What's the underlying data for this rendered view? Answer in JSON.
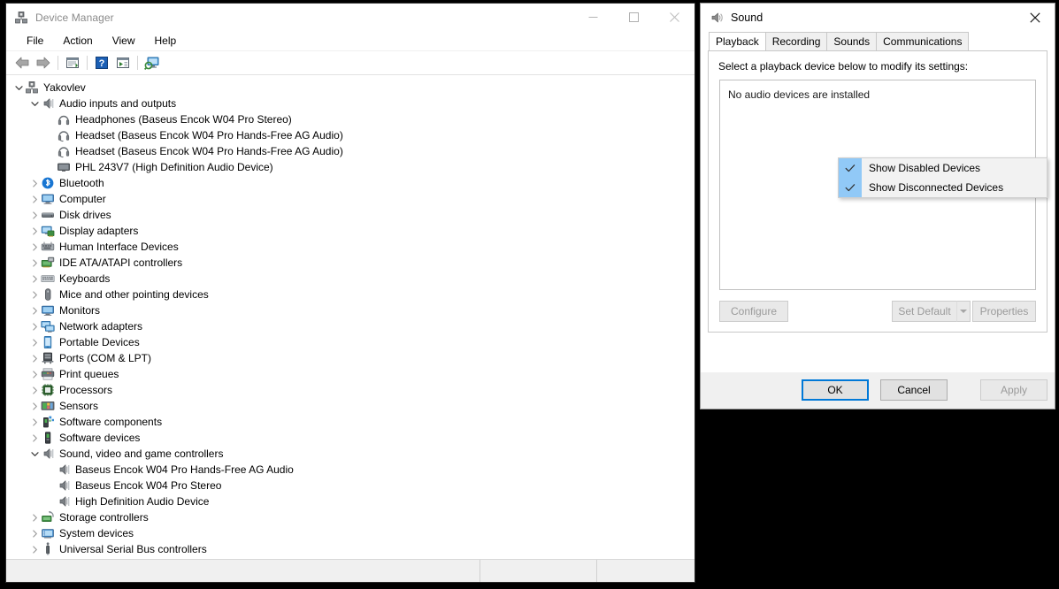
{
  "device_manager": {
    "title": "Device Manager",
    "title_icon": "device-manager-icon",
    "window_buttons": [
      {
        "name": "minimize",
        "glyph": "minimize-icon"
      },
      {
        "name": "maximize",
        "glyph": "maximize-icon"
      },
      {
        "name": "close",
        "glyph": "close-icon"
      }
    ],
    "menu": [
      "File",
      "Action",
      "View",
      "Help"
    ],
    "toolbar": [
      {
        "name": "back-icon"
      },
      {
        "name": "forward-icon"
      },
      {
        "sep": true
      },
      {
        "name": "properties-icon"
      },
      {
        "sep": true
      },
      {
        "name": "help-icon"
      },
      {
        "name": "update-driver-icon"
      },
      {
        "sep": true
      },
      {
        "name": "scan-hardware-icon"
      }
    ],
    "tree": [
      {
        "label": "Yakovlev",
        "indent": 0,
        "twisty": "down",
        "icon": "computer-tree-icon"
      },
      {
        "label": "Audio inputs and outputs",
        "indent": 1,
        "twisty": "down",
        "icon": "speaker-icon"
      },
      {
        "label": "Headphones (Baseus Encok W04 Pro Stereo)",
        "indent": 2,
        "twisty": "none",
        "icon": "headphones-icon"
      },
      {
        "label": "Headset (Baseus Encok W04 Pro Hands-Free AG Audio)",
        "indent": 2,
        "twisty": "none",
        "icon": "headset-icon"
      },
      {
        "label": "Headset (Baseus Encok W04 Pro Hands-Free AG Audio)",
        "indent": 2,
        "twisty": "none",
        "icon": "headset-icon"
      },
      {
        "label": "PHL 243V7 (High Definition Audio Device)",
        "indent": 2,
        "twisty": "none",
        "icon": "monitor-icon"
      },
      {
        "label": "Bluetooth",
        "indent": 1,
        "twisty": "right",
        "icon": "bluetooth-icon"
      },
      {
        "label": "Computer",
        "indent": 1,
        "twisty": "right",
        "icon": "computer-icon"
      },
      {
        "label": "Disk drives",
        "indent": 1,
        "twisty": "right",
        "icon": "disk-icon"
      },
      {
        "label": "Display adapters",
        "indent": 1,
        "twisty": "right",
        "icon": "display-adapter-icon"
      },
      {
        "label": "Human Interface Devices",
        "indent": 1,
        "twisty": "right",
        "icon": "hid-icon"
      },
      {
        "label": "IDE ATA/ATAPI controllers",
        "indent": 1,
        "twisty": "right",
        "icon": "ide-icon"
      },
      {
        "label": "Keyboards",
        "indent": 1,
        "twisty": "right",
        "icon": "keyboard-icon"
      },
      {
        "label": "Mice and other pointing devices",
        "indent": 1,
        "twisty": "right",
        "icon": "mouse-icon"
      },
      {
        "label": "Monitors",
        "indent": 1,
        "twisty": "right",
        "icon": "monitor2-icon"
      },
      {
        "label": "Network adapters",
        "indent": 1,
        "twisty": "right",
        "icon": "network-icon"
      },
      {
        "label": "Portable Devices",
        "indent": 1,
        "twisty": "right",
        "icon": "portable-icon"
      },
      {
        "label": "Ports (COM & LPT)",
        "indent": 1,
        "twisty": "right",
        "icon": "port-icon"
      },
      {
        "label": "Print queues",
        "indent": 1,
        "twisty": "right",
        "icon": "printer-icon"
      },
      {
        "label": "Processors",
        "indent": 1,
        "twisty": "right",
        "icon": "processor-icon"
      },
      {
        "label": "Sensors",
        "indent": 1,
        "twisty": "right",
        "icon": "sensor-icon"
      },
      {
        "label": "Software components",
        "indent": 1,
        "twisty": "right",
        "icon": "software-component-icon"
      },
      {
        "label": "Software devices",
        "indent": 1,
        "twisty": "right",
        "icon": "software-device-icon"
      },
      {
        "label": "Sound, video and game controllers",
        "indent": 1,
        "twisty": "down",
        "icon": "speaker-icon"
      },
      {
        "label": "Baseus Encok W04 Pro Hands-Free AG Audio",
        "indent": 2,
        "twisty": "none",
        "icon": "speaker-small-icon"
      },
      {
        "label": "Baseus Encok W04 Pro Stereo",
        "indent": 2,
        "twisty": "none",
        "icon": "speaker-small-icon"
      },
      {
        "label": "High Definition Audio Device",
        "indent": 2,
        "twisty": "none",
        "icon": "speaker-small-icon"
      },
      {
        "label": "Storage controllers",
        "indent": 1,
        "twisty": "right",
        "icon": "storage-icon"
      },
      {
        "label": "System devices",
        "indent": 1,
        "twisty": "right",
        "icon": "system-icon"
      },
      {
        "label": "Universal Serial Bus controllers",
        "indent": 1,
        "twisty": "right",
        "icon": "usb-icon"
      }
    ],
    "status_bar": [
      "",
      "",
      ""
    ]
  },
  "sound_dialog": {
    "title": "Sound",
    "title_icon": "sound-icon",
    "close_label": "close-icon",
    "tabs": [
      {
        "label": "Playback",
        "active": true
      },
      {
        "label": "Recording",
        "active": false
      },
      {
        "label": "Sounds",
        "active": false
      },
      {
        "label": "Communications",
        "active": false
      }
    ],
    "panel_label": "Select a playback device below to modify its settings:",
    "device_list_empty_text": "No audio devices are installed",
    "panel_buttons": {
      "configure": "Configure",
      "set_default": "Set Default",
      "properties": "Properties"
    },
    "footer_buttons": {
      "ok": "OK",
      "cancel": "Cancel",
      "apply": "Apply"
    }
  },
  "context_menu": {
    "items": [
      {
        "label": "Show Disabled Devices",
        "checked": true
      },
      {
        "label": "Show Disconnected Devices",
        "checked": true
      }
    ]
  },
  "colors": {
    "accent": "#0078d7",
    "menu_check_bg": "#91c9f7",
    "window_bg": "#f0f0f0",
    "disabled_text": "#9a9a9a"
  }
}
